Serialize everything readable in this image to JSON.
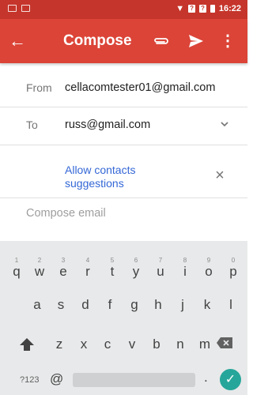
{
  "status_bar": {
    "time": "16:22",
    "badge1": "?",
    "badge2": "?"
  },
  "app_bar": {
    "title": "Compose",
    "back_icon": "arrow-back-icon",
    "attach_icon": "paperclip-icon",
    "send_icon": "send-icon",
    "more_icon": "more-vert-icon"
  },
  "from": {
    "label": "From",
    "value": "cellacomtester01@gmail.com"
  },
  "to": {
    "label": "To",
    "value": "russ@gmail.com"
  },
  "suggestions": {
    "label": "Allow contacts suggestions"
  },
  "body": {
    "placeholder": "Compose email"
  },
  "keyboard": {
    "row1": [
      {
        "key": "q",
        "hint": "1"
      },
      {
        "key": "w",
        "hint": "2"
      },
      {
        "key": "e",
        "hint": "3"
      },
      {
        "key": "r",
        "hint": "4"
      },
      {
        "key": "t",
        "hint": "5"
      },
      {
        "key": "y",
        "hint": "6"
      },
      {
        "key": "u",
        "hint": "7"
      },
      {
        "key": "i",
        "hint": "8"
      },
      {
        "key": "o",
        "hint": "9"
      },
      {
        "key": "p",
        "hint": "0"
      }
    ],
    "row2": [
      "a",
      "s",
      "d",
      "f",
      "g",
      "h",
      "j",
      "k",
      "l"
    ],
    "row3": [
      "z",
      "x",
      "c",
      "v",
      "b",
      "n",
      "m"
    ],
    "symbols_label": "?123",
    "at_label": "@",
    "period_label": ".",
    "accent_color": "#26a69a"
  },
  "colors": {
    "status_bar": "#c5352b",
    "app_bar": "#db4437",
    "link": "#3367d6"
  }
}
